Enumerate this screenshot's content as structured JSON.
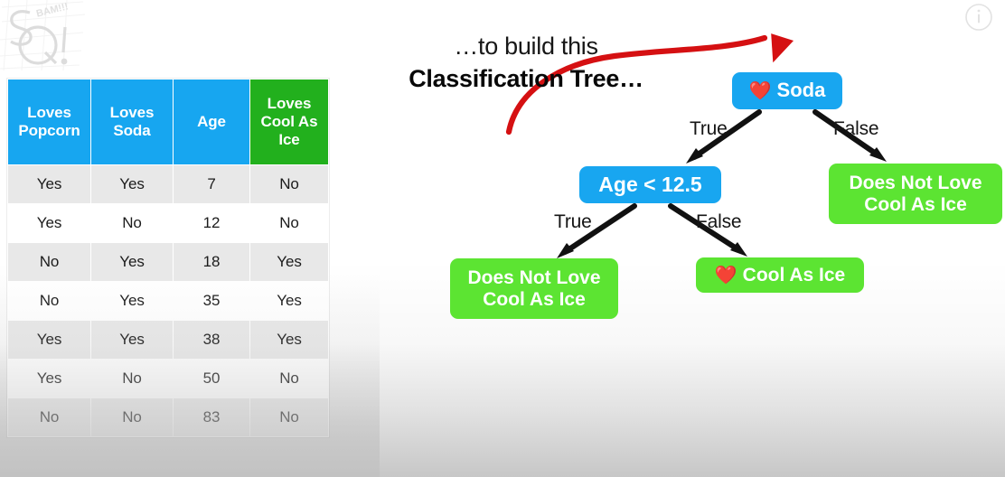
{
  "background": {
    "top_color": "#ffffff",
    "bottom_color": "#c7c7c7"
  },
  "watermark": {
    "name": "statquest-logo-watermark",
    "text_main": "SQ!",
    "text_badge": "BAM!!!"
  },
  "info_icon": {
    "name": "info-icon",
    "glyph": "i"
  },
  "headline": {
    "line1": "…to build this",
    "line2": "Classification Tree…"
  },
  "arrow": {
    "name": "red-curved-arrow",
    "color": "#d51012"
  },
  "table": {
    "header_blue": "#17a6f0",
    "header_green": "#22b01d",
    "columns": [
      {
        "label": "Loves Popcorn",
        "color": "blue"
      },
      {
        "label": "Loves Soda",
        "color": "blue"
      },
      {
        "label": "Age",
        "color": "blue"
      },
      {
        "label": "Loves Cool As Ice",
        "color": "green"
      }
    ],
    "column_lines": [
      [
        "Loves",
        "Popcorn"
      ],
      [
        "Loves",
        "Soda"
      ],
      [
        "Age"
      ],
      [
        "Loves",
        "Cool As",
        "Ice"
      ]
    ],
    "rows": [
      {
        "loves_popcorn": "Yes",
        "loves_soda": "Yes",
        "age": "7",
        "loves_cool_as_ice": "No"
      },
      {
        "loves_popcorn": "Yes",
        "loves_soda": "No",
        "age": "12",
        "loves_cool_as_ice": "No"
      },
      {
        "loves_popcorn": "No",
        "loves_soda": "Yes",
        "age": "18",
        "loves_cool_as_ice": "Yes"
      },
      {
        "loves_popcorn": "No",
        "loves_soda": "Yes",
        "age": "35",
        "loves_cool_as_ice": "Yes"
      },
      {
        "loves_popcorn": "Yes",
        "loves_soda": "Yes",
        "age": "38",
        "loves_cool_as_ice": "Yes"
      },
      {
        "loves_popcorn": "Yes",
        "loves_soda": "No",
        "age": "50",
        "loves_cool_as_ice": "No"
      },
      {
        "loves_popcorn": "No",
        "loves_soda": "No",
        "age": "83",
        "loves_cool_as_ice": "No"
      }
    ]
  },
  "tree": {
    "node_blue_color": "#18a6f0",
    "node_green_color": "#5ce432",
    "heart_emoji": "❤️",
    "root": {
      "emoji": "❤️",
      "label": "Soda"
    },
    "split": {
      "label": "Age < 12.5"
    },
    "leaf_right": {
      "label_line1": "Does Not Love",
      "label_line2": "Cool As Ice"
    },
    "leaf_bottom_left": {
      "label_line1": "Does Not Love",
      "label_line2": "Cool As Ice"
    },
    "leaf_bottom_right": {
      "emoji": "❤️",
      "label": "Cool As Ice"
    },
    "edges": {
      "root_true": "True",
      "root_false": "False",
      "split_true": "True",
      "split_false": "False"
    }
  }
}
